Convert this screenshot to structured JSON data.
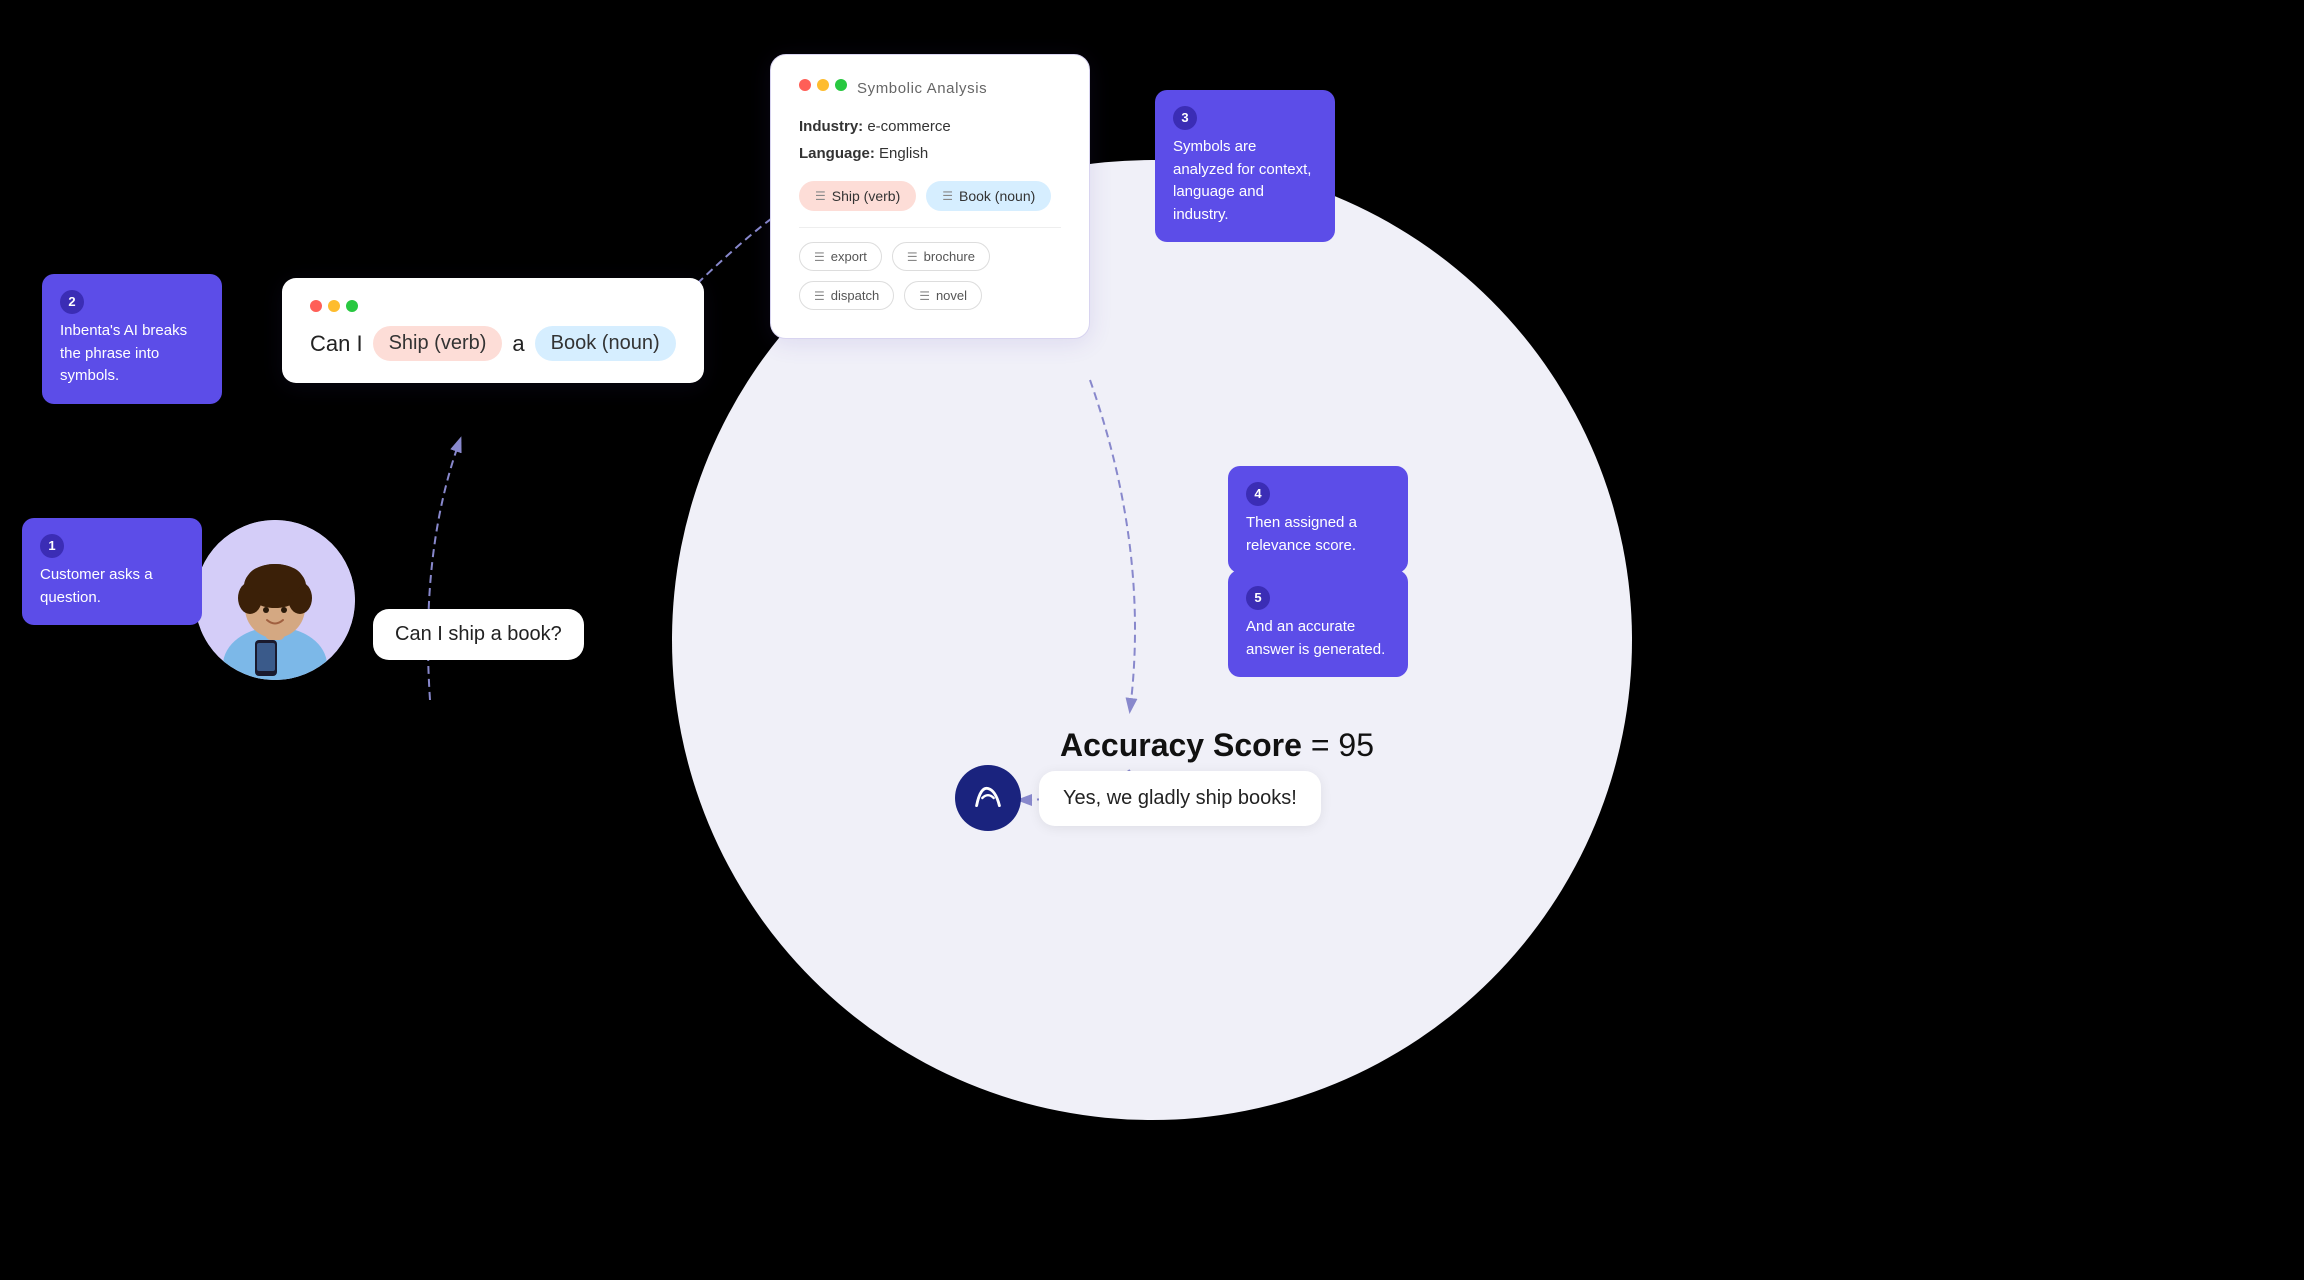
{
  "circle": {},
  "phrase_card": {
    "text_can": "Can I",
    "text_a": "a",
    "tag_ship": "Ship (verb)",
    "tag_book": "Book (noun)"
  },
  "analysis_card": {
    "title": "Symbolic Analysis",
    "industry_label": "Industry:",
    "industry_value": "e-commerce",
    "language_label": "Language:",
    "language_value": "English",
    "tag_ship": "Ship (verb)",
    "tag_book": "Book (noun)",
    "secondary_tags": [
      "export",
      "brochure",
      "dispatch",
      "novel"
    ]
  },
  "accuracy": {
    "label_bold": "Accuracy Score",
    "label_rest": " = 95"
  },
  "answer": {
    "text": "Yes, we gladly ship books!"
  },
  "question": {
    "text": "Can I ship a book?"
  },
  "tooltips": [
    {
      "num": "1",
      "text": "Customer asks a question."
    },
    {
      "num": "2",
      "text": "Inbenta's AI breaks the phrase into symbols."
    },
    {
      "num": "3",
      "text": "Symbols are analyzed for context, language and industry."
    },
    {
      "num": "4",
      "text": "Then assigned a relevance score."
    },
    {
      "num": "5",
      "text": "And an accurate answer is generated."
    }
  ]
}
